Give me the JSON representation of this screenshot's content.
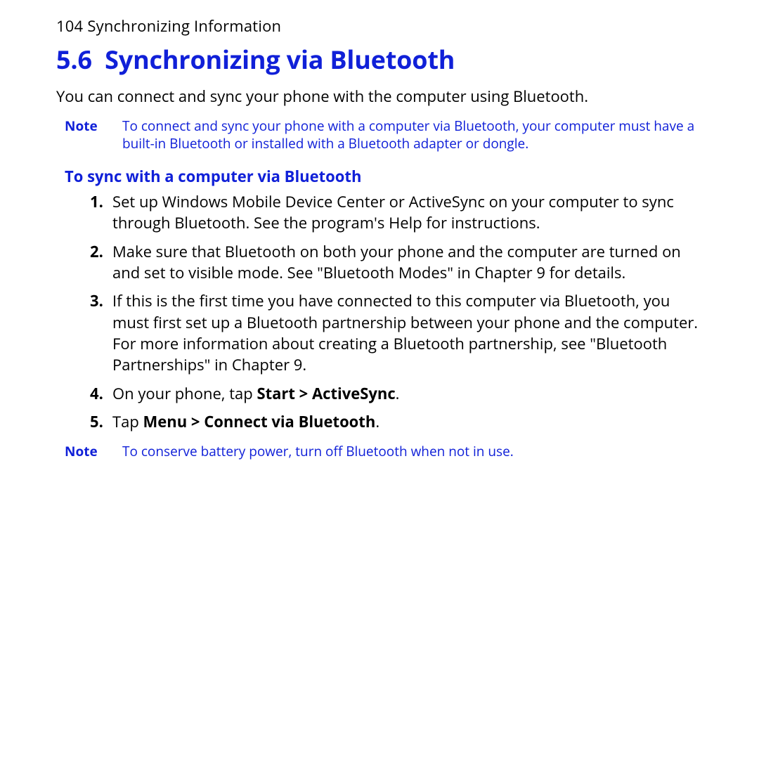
{
  "header": {
    "page_number": "104",
    "running_title": "Synchronizing Information"
  },
  "section": {
    "number": "5.6",
    "title": "Synchronizing via Bluetooth"
  },
  "intro": "You can connect and sync your phone with the computer using Bluetooth.",
  "note1": {
    "label": "Note",
    "text": "To connect and sync your phone with a computer via Bluetooth, your computer must have a built-in Bluetooth or installed with a Bluetooth adapter or dongle."
  },
  "sub_heading": "To sync with a computer via Bluetooth",
  "steps": {
    "s1": "Set up Windows Mobile Device Center or ActiveSync on your computer to sync through Bluetooth. See the program's Help for instructions.",
    "s2": "Make sure that Bluetooth on both your phone and the computer are turned on and set to visible mode. See \"Bluetooth Modes\" in Chapter 9 for details.",
    "s3": "If this is the first time you have connected to this computer via Bluetooth, you must first set up a Bluetooth partnership between your phone and the computer. For more information about creating a Bluetooth partnership, see \"Bluetooth Partnerships\" in Chapter 9.",
    "s4_pre": "On your phone, tap ",
    "s4_bold": "Start > ActiveSync",
    "s4_post": ".",
    "s5_pre": "Tap ",
    "s5_bold": "Menu > Connect via Bluetooth",
    "s5_post": "."
  },
  "note2": {
    "label": "Note",
    "text": "To conserve battery power, turn off Bluetooth when not in use."
  }
}
